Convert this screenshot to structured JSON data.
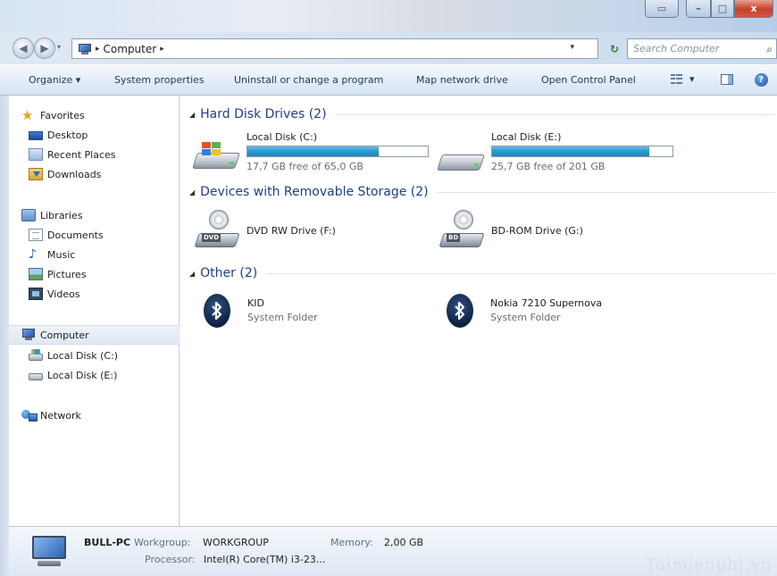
{
  "window": {
    "controls": {
      "special": "▭",
      "minimize": "–",
      "maximize": "□",
      "close": "x"
    }
  },
  "address": {
    "back": "◀",
    "forward": "▶",
    "breadcrumb": [
      "Computer"
    ],
    "search_placeholder": "Search Computer",
    "refresh_label": "↻"
  },
  "toolbar": {
    "organize": "Organize ▾",
    "system_properties": "System properties",
    "uninstall": "Uninstall or change a program",
    "map_network_drive": "Map network drive",
    "open_control_panel": "Open Control Panel",
    "views_dropdown": "▾",
    "help": "?"
  },
  "navpane": {
    "favorites": {
      "label": "Favorites",
      "items": [
        "Desktop",
        "Recent Places",
        "Downloads"
      ]
    },
    "libraries": {
      "label": "Libraries",
      "items": [
        "Documents",
        "Music",
        "Pictures",
        "Videos"
      ]
    },
    "computer": {
      "label": "Computer",
      "items": [
        "Local Disk (C:)",
        "Local Disk (E:)"
      ]
    },
    "network": {
      "label": "Network"
    }
  },
  "content": {
    "groups": [
      {
        "header": "Hard Disk Drives (2)",
        "items": [
          {
            "name": "Local Disk (C:)",
            "free_text": "17,7 GB free of 65,0 GB",
            "used_fraction": 0.73,
            "icon": "windows-drive-icon"
          },
          {
            "name": "Local Disk (E:)",
            "free_text": "25,7 GB free of 201 GB",
            "used_fraction": 0.87,
            "icon": "hard-drive-icon"
          }
        ]
      },
      {
        "header": "Devices with Removable Storage (2)",
        "items": [
          {
            "name": "DVD RW Drive (F:)",
            "badge": "DVD",
            "icon": "dvd-drive-icon"
          },
          {
            "name": "BD-ROM Drive (G:)",
            "badge": "BD",
            "icon": "bd-drive-icon"
          }
        ]
      },
      {
        "header": "Other (2)",
        "items": [
          {
            "name": "KID",
            "type": "System Folder",
            "icon": "bluetooth-icon"
          },
          {
            "name": "Nokia 7210 Supernova",
            "type": "System Folder",
            "icon": "bluetooth-icon"
          }
        ]
      }
    ]
  },
  "details": {
    "computer_name": "BULL-PC",
    "workgroup_label": "Workgroup:",
    "workgroup_value": "WORKGROUP",
    "memory_label": "Memory:",
    "memory_value": "2,00 GB",
    "processor_label": "Processor:",
    "processor_value": "Intel(R) Core(TM) i3-23..."
  },
  "watermark": "Taimienphi.vn",
  "colors": {
    "group_header": "#1e3f87",
    "capacity_fill": "#2a98cf",
    "toolbar_text": "#1e395b"
  }
}
